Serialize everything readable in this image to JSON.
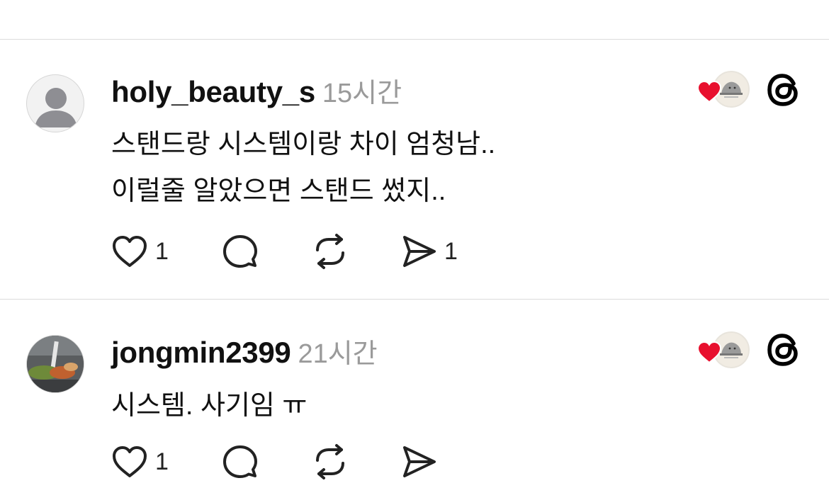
{
  "posts": [
    {
      "username": "holy_beauty_s",
      "time": "15시간",
      "lines": [
        "스탠드랑 시스템이랑 차이 엄청남..",
        "이럴줄 알았으면 스탠드 썼지.."
      ],
      "likes": "1",
      "shares": "1",
      "avatar_type": "default"
    },
    {
      "username": "jongmin2399",
      "time": "21시간",
      "lines": [
        "시스템. 사기임 ㅠ"
      ],
      "likes": "1",
      "shares": "",
      "avatar_type": "photo"
    }
  ],
  "colors": {
    "heart": "#e8102e",
    "timestamp": "#9a9a9a",
    "divider": "#dcdcdc"
  },
  "icons": [
    "heart-icon",
    "comment-icon",
    "repost-icon",
    "share-icon",
    "threads-logo-icon"
  ]
}
